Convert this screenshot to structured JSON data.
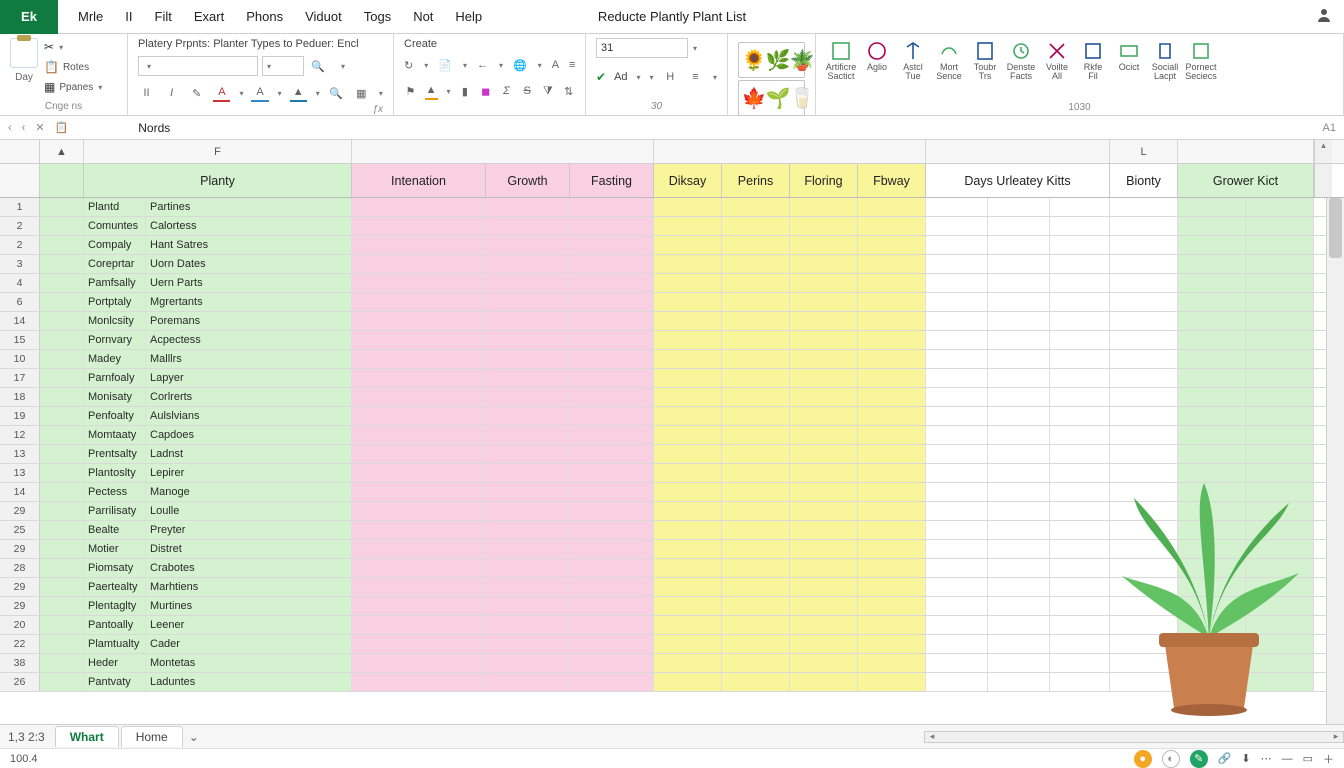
{
  "app": {
    "button": "Ek",
    "title": "Reducte Plantly Plant List"
  },
  "menu": [
    "Mrle",
    "II",
    "Filt",
    "Exart",
    "Phons",
    "Viduot",
    "Togs",
    "Not",
    "Help"
  ],
  "ribbon": {
    "g1": {
      "paste": "Day",
      "notes": "Rotes",
      "panes": "Ppanes",
      "footer": "Cnge ns"
    },
    "g2": {
      "title": "Platery Prpnts: Planter Types to Peduer: Encl"
    },
    "g3": {
      "title": "Create"
    },
    "g4": {
      "add": "Ad",
      "input": "31"
    },
    "g5_footer": "30",
    "tools": [
      {
        "l1": "Artificre",
        "l2": "Sactict"
      },
      {
        "l1": "Aglio",
        "l2": ""
      },
      {
        "l1": "Astcl",
        "l2": "Tue"
      },
      {
        "l1": "Mort",
        "l2": "Sence"
      },
      {
        "l1": "Toubr",
        "l2": "Trs"
      },
      {
        "l1": "Denste",
        "l2": "Facts"
      },
      {
        "l1": "Voilte",
        "l2": "All"
      },
      {
        "l1": "Rkfe",
        "l2": "Fil"
      },
      {
        "l1": "Ocict",
        "l2": ""
      },
      {
        "l1": "Sociall",
        "l2": "Lacpt"
      },
      {
        "l1": "Pornect",
        "l2": "Seciecs"
      }
    ],
    "tools_footer": "1030"
  },
  "formula": {
    "value": "Nords",
    "cellref": "A1"
  },
  "colLetters": {
    "A": "▲",
    "F": "F",
    "L": "L"
  },
  "headers": {
    "planty": "Planty",
    "intenation": "Intenation",
    "growth": "Growth",
    "fasting": "Fasting",
    "diksay": "Diksay",
    "perins": "Perins",
    "floring": "Floring",
    "fbway": "Fbway",
    "days": "Days Urleatey Kitts",
    "bionty": "Bionty",
    "grower": "Grower Kict"
  },
  "rows": [
    {
      "n": "1",
      "a": "Plantd",
      "b": "Partines"
    },
    {
      "n": "2",
      "a": "Comuntes",
      "b": "Calortess"
    },
    {
      "n": "2",
      "a": "Compaly",
      "b": "Hant Satres"
    },
    {
      "n": "3",
      "a": "Coreprtar",
      "b": "Uorn Dates"
    },
    {
      "n": "4",
      "a": "Pamfsally",
      "b": "Uern Parts"
    },
    {
      "n": "6",
      "a": "Portptaly",
      "b": "Mgrertants"
    },
    {
      "n": "14",
      "a": "Monlcsity",
      "b": "Poremans"
    },
    {
      "n": "15",
      "a": "Pornvary",
      "b": "Acpectess"
    },
    {
      "n": "10",
      "a": "Madey",
      "b": "Malllrs"
    },
    {
      "n": "17",
      "a": "Parnfoaly",
      "b": "Lapyer"
    },
    {
      "n": "18",
      "a": "Monisaty",
      "b": "Corlrerts"
    },
    {
      "n": "19",
      "a": "Penfoalty",
      "b": "Aulslvians"
    },
    {
      "n": "12",
      "a": "Momtaaty",
      "b": "Capdoes"
    },
    {
      "n": "13",
      "a": "Prentsalty",
      "b": "Ladnst"
    },
    {
      "n": "13",
      "a": "Plantoslty",
      "b": "Lepirer"
    },
    {
      "n": "14",
      "a": "Pectess",
      "b": "Manoge"
    },
    {
      "n": "29",
      "a": "Parrilisaty",
      "b": "Loulle"
    },
    {
      "n": "25",
      "a": "Bealte",
      "b": "Preyter"
    },
    {
      "n": "29",
      "a": "Motier",
      "b": "Distret"
    },
    {
      "n": "28",
      "a": "Piomsaty",
      "b": "Crabotes"
    },
    {
      "n": "29",
      "a": "Paertealty",
      "b": "Marhtiens"
    },
    {
      "n": "29",
      "a": "Plentaglty",
      "b": "Murtines"
    },
    {
      "n": "20",
      "a": "Pantoally",
      "b": "Leener"
    },
    {
      "n": "22",
      "a": "Plamtualty",
      "b": "Cader"
    },
    {
      "n": "38",
      "a": "Heder",
      "b": "Montetas"
    },
    {
      "n": "26",
      "a": "Pantvaty",
      "b": "Laduntes"
    }
  ],
  "tabs": {
    "active": "Whart",
    "other": "Home",
    "leftnum": "1,3 2:3"
  },
  "status": {
    "left": "100.4"
  }
}
